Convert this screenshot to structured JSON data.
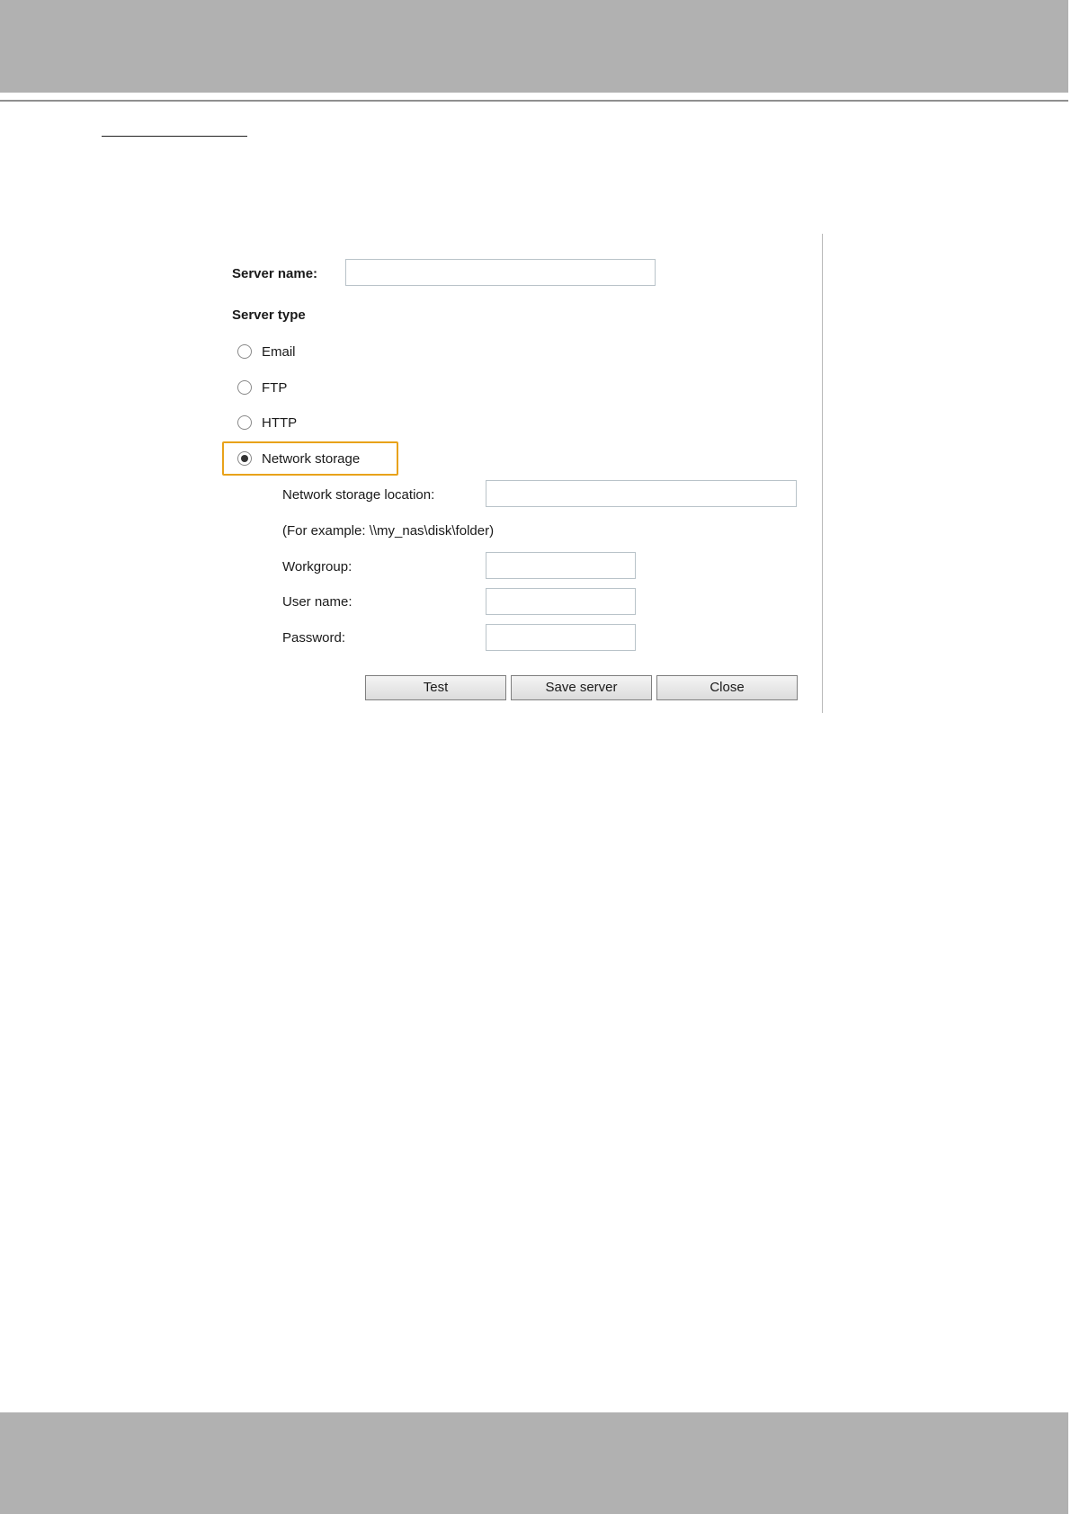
{
  "form": {
    "server_name_label": "Server name:",
    "server_name_value": "",
    "server_type_label": "Server type",
    "options": [
      {
        "label": "Email",
        "checked": false
      },
      {
        "label": "FTP",
        "checked": false
      },
      {
        "label": "HTTP",
        "checked": false
      },
      {
        "label": "Network storage",
        "checked": true
      }
    ],
    "network_storage": {
      "location_label": "Network storage location:",
      "location_value": "",
      "example_text": "(For example: \\\\my_nas\\disk\\folder)",
      "workgroup_label": "Workgroup:",
      "workgroup_value": "",
      "username_label": "User name:",
      "username_value": "",
      "password_label": "Password:",
      "password_value": ""
    },
    "buttons": {
      "test": "Test",
      "save": "Save server",
      "close": "Close"
    }
  },
  "colors": {
    "band_gray": "#b1b1b1",
    "highlight": "#e8a21a"
  }
}
